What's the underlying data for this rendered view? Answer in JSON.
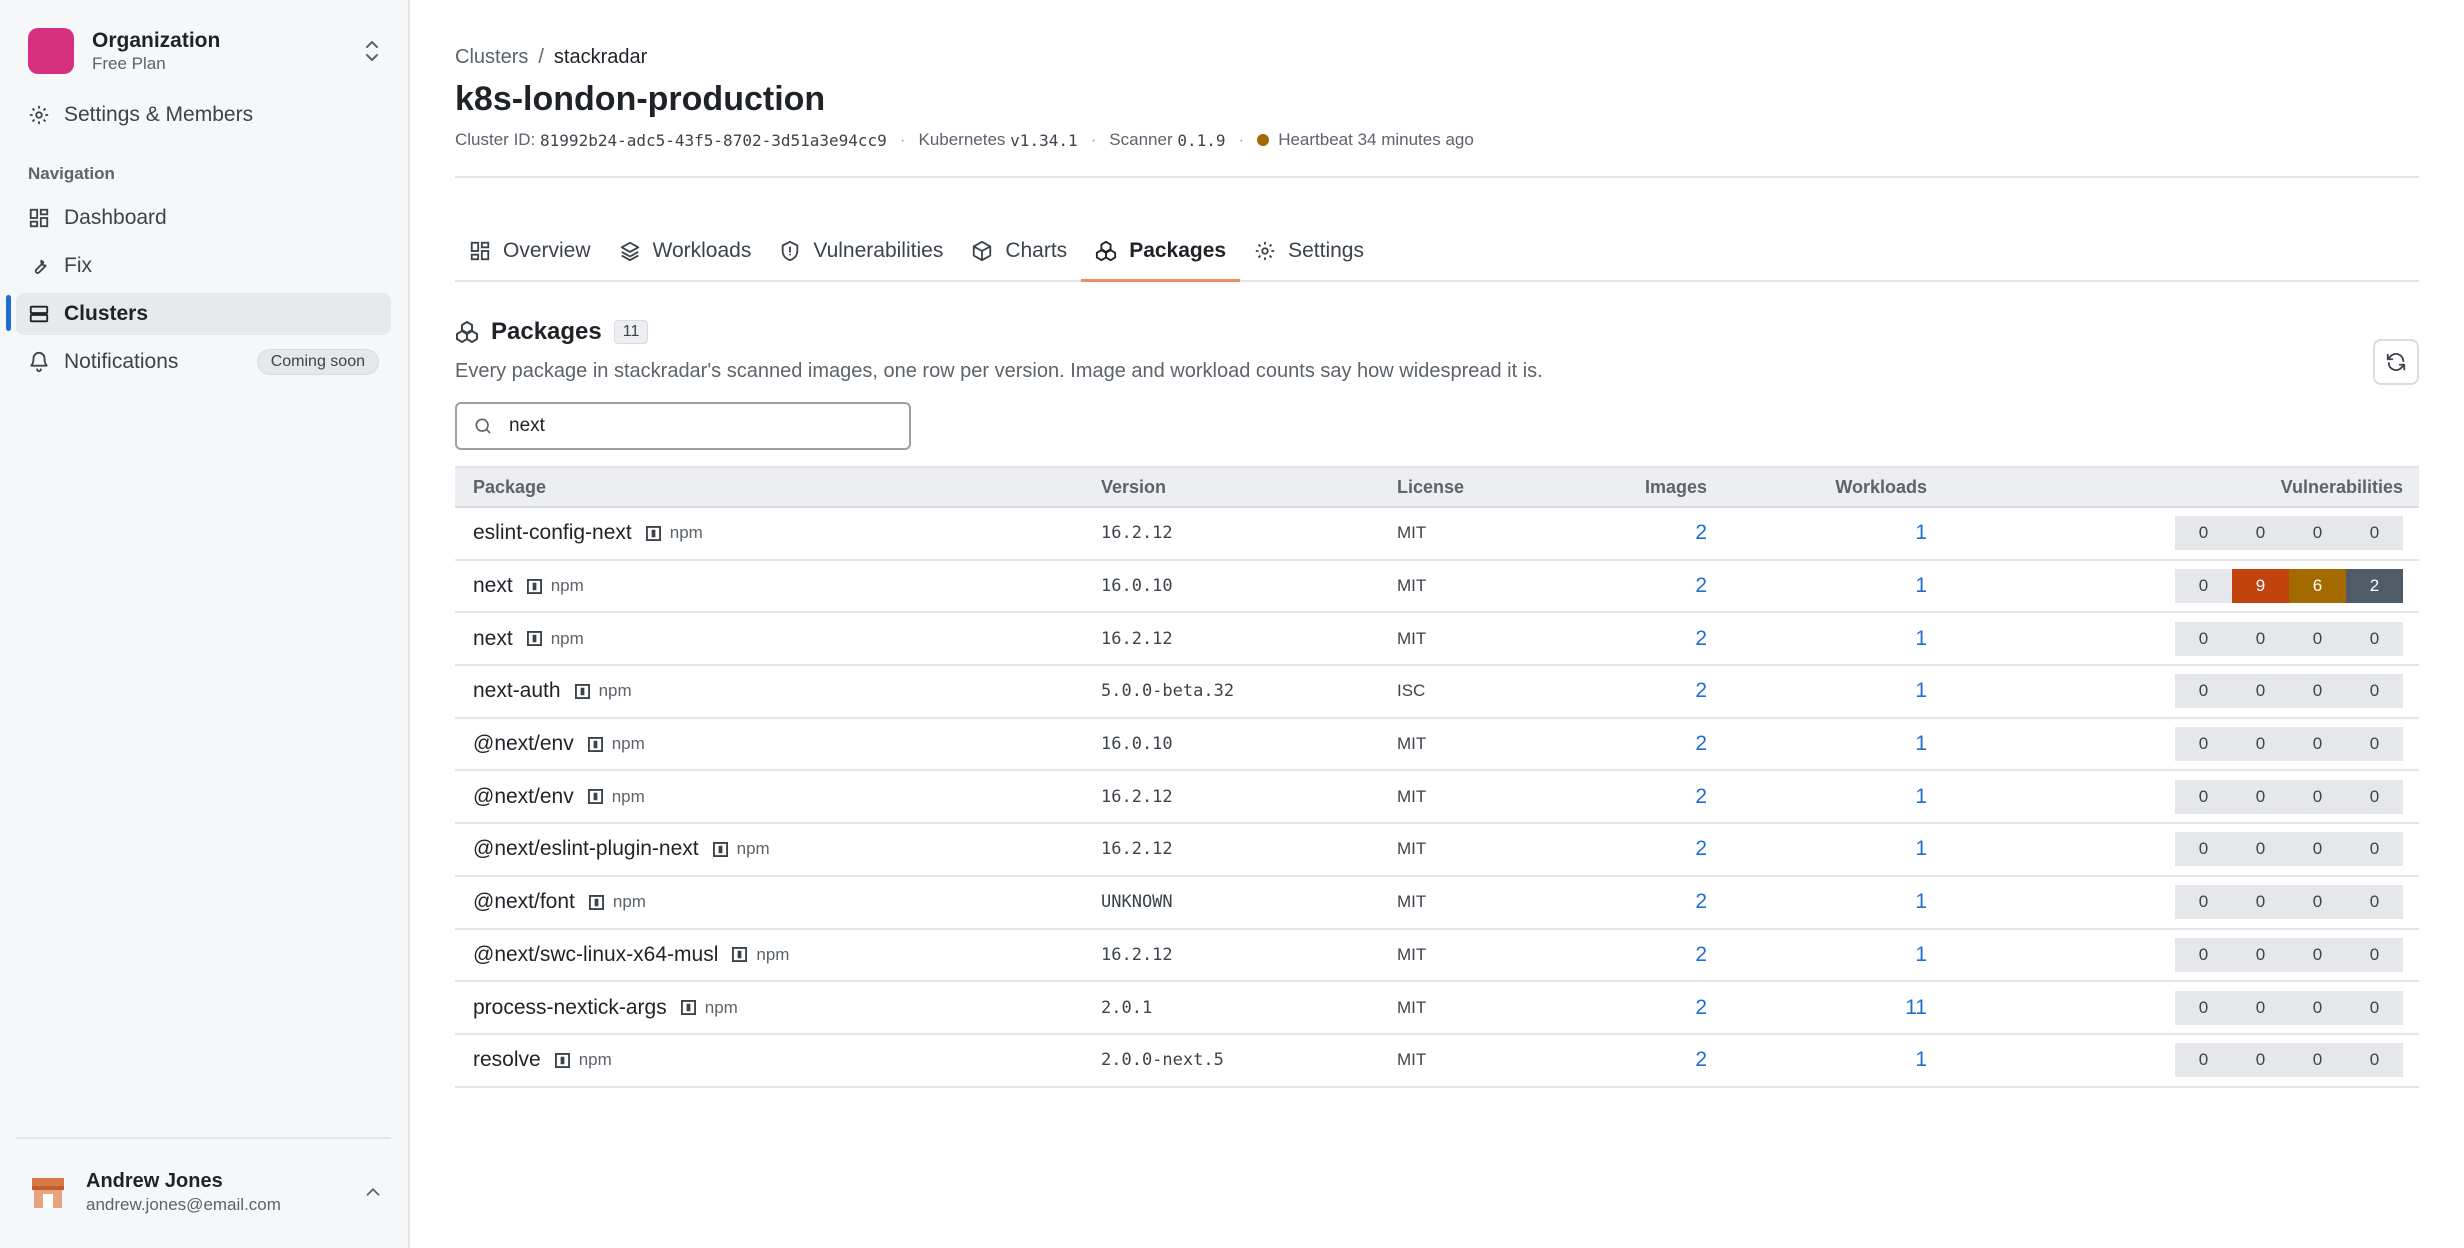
{
  "sidebar": {
    "org_name": "Organization",
    "org_plan": "Free Plan",
    "settings_label": "Settings & Members",
    "section_label": "Navigation",
    "items": [
      {
        "label": "Dashboard",
        "icon": "dashboard-icon"
      },
      {
        "label": "Fix",
        "icon": "wrench-icon"
      },
      {
        "label": "Clusters",
        "icon": "server-icon",
        "active": true
      },
      {
        "label": "Notifications",
        "icon": "bell-icon",
        "badge": "Coming soon"
      }
    ],
    "user": {
      "name": "Andrew Jones",
      "email": "andrew.jones@email.com"
    }
  },
  "header": {
    "breadcrumb": [
      "Clusters",
      "stackradar"
    ],
    "title": "k8s-london-production",
    "cluster_id_label": "Cluster ID:",
    "cluster_id": "81992b24-adc5-43f5-8702-3d51a3e94cc9",
    "kubernetes_label": "Kubernetes",
    "kubernetes_version": "v1.34.1",
    "scanner_label": "Scanner",
    "scanner_version": "0.1.9",
    "heartbeat": "Heartbeat 34 minutes ago",
    "heartbeat_color": "#a36a00"
  },
  "tabs": [
    {
      "label": "Overview",
      "icon": "overview-icon"
    },
    {
      "label": "Workloads",
      "icon": "layers-icon"
    },
    {
      "label": "Vulnerabilities",
      "icon": "shield-icon"
    },
    {
      "label": "Charts",
      "icon": "box-icon"
    },
    {
      "label": "Packages",
      "icon": "packages-icon",
      "active": true
    },
    {
      "label": "Settings",
      "icon": "gear-icon"
    }
  ],
  "packages": {
    "title": "Packages",
    "count": "11",
    "description": "Every package in stackradar's scanned images, one row per version. Image and workload counts say how widespread it is.",
    "search_value": "next",
    "columns": {
      "package": "Package",
      "version": "Version",
      "license": "License",
      "images": "Images",
      "workloads": "Workloads",
      "vulnerabilities": "Vulnerabilities"
    },
    "rows": [
      {
        "name": "eslint-config-next",
        "type": "npm",
        "version": "16.2.12",
        "license": "MIT",
        "images": "2",
        "workloads": "1",
        "vulns": [
          "0",
          "0",
          "0",
          "0"
        ]
      },
      {
        "name": "next",
        "type": "npm",
        "version": "16.0.10",
        "license": "MIT",
        "images": "2",
        "workloads": "1",
        "vulns": [
          "0",
          "9",
          "6",
          "2"
        ]
      },
      {
        "name": "next",
        "type": "npm",
        "version": "16.2.12",
        "license": "MIT",
        "images": "2",
        "workloads": "1",
        "vulns": [
          "0",
          "0",
          "0",
          "0"
        ]
      },
      {
        "name": "next-auth",
        "type": "npm",
        "version": "5.0.0-beta.32",
        "license": "ISC",
        "images": "2",
        "workloads": "1",
        "vulns": [
          "0",
          "0",
          "0",
          "0"
        ]
      },
      {
        "name": "@next/env",
        "type": "npm",
        "version": "16.0.10",
        "license": "MIT",
        "images": "2",
        "workloads": "1",
        "vulns": [
          "0",
          "0",
          "0",
          "0"
        ]
      },
      {
        "name": "@next/env",
        "type": "npm",
        "version": "16.2.12",
        "license": "MIT",
        "images": "2",
        "workloads": "1",
        "vulns": [
          "0",
          "0",
          "0",
          "0"
        ]
      },
      {
        "name": "@next/eslint-plugin-next",
        "type": "npm",
        "version": "16.2.12",
        "license": "MIT",
        "images": "2",
        "workloads": "1",
        "vulns": [
          "0",
          "0",
          "0",
          "0"
        ]
      },
      {
        "name": "@next/font",
        "type": "npm",
        "version": "UNKNOWN",
        "license": "MIT",
        "images": "2",
        "workloads": "1",
        "vulns": [
          "0",
          "0",
          "0",
          "0"
        ]
      },
      {
        "name": "@next/swc-linux-x64-musl",
        "type": "npm",
        "version": "16.2.12",
        "license": "MIT",
        "images": "2",
        "workloads": "1",
        "vulns": [
          "0",
          "0",
          "0",
          "0"
        ]
      },
      {
        "name": "process-nextick-args",
        "type": "npm",
        "version": "2.0.1",
        "license": "MIT",
        "images": "2",
        "workloads": "11",
        "vulns": [
          "0",
          "0",
          "0",
          "0"
        ]
      },
      {
        "name": "resolve",
        "type": "npm",
        "version": "2.0.0-next.5",
        "license": "MIT",
        "images": "2",
        "workloads": "1",
        "vulns": [
          "0",
          "0",
          "0",
          "0"
        ]
      }
    ]
  },
  "colors": {
    "accent": "#1f6fd1",
    "brand": "#d6307f",
    "tab_underline": "#f08a63",
    "critical": "#c1440e",
    "high": "#a36a00",
    "medium": "#4f5b66"
  }
}
